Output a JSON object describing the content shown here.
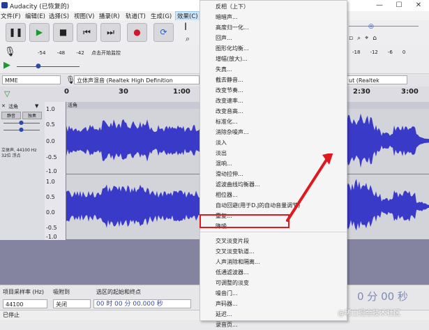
{
  "window": {
    "title": "Audacity (已恢复的)",
    "minimize": "—",
    "maximize": "☐",
    "close": "✕"
  },
  "menubar": [
    "文件(F)",
    "编辑(E)",
    "选择(S)",
    "视图(V)",
    "播录(R)",
    "轨道(T)",
    "生成(G)",
    "效果(C)"
  ],
  "transport": [
    "pause",
    "play",
    "stop",
    "skip-start",
    "skip-end",
    "record",
    "loop"
  ],
  "meter": {
    "ticks": [
      "-54",
      "-48",
      "-42"
    ],
    "hint": "点击开始监控",
    "ticks_right": [
      "-18",
      "-12",
      "-6",
      "0"
    ]
  },
  "device": {
    "host": "MME",
    "input": "立体声混音 (Realtek High Definition",
    "output_tail": "ut (Realtek"
  },
  "ruler": {
    "labels": [
      "0",
      "30",
      "1:00",
      "2:30",
      "3:00"
    ]
  },
  "track": {
    "close": "✕",
    "name": "活角",
    "mute": "静音",
    "solo": "独奏",
    "info": "立体声, 44100 Hz\n32位 浮点",
    "clip_name": "活角",
    "scale_top": [
      "1.0",
      "0.5",
      "0.0",
      "-0.5",
      "-1.0"
    ],
    "scale_bottom": [
      "1.0",
      "0.5",
      "0.0",
      "-0.5",
      "-1.0"
    ]
  },
  "selection_bar": {
    "rate_label": "项目采样率 (Hz)",
    "snap_label": "吸附到",
    "range_label": "选区的起始和终点",
    "rate_value": "44100",
    "snap_value": "关闭",
    "time_value": "00 时 00 分 00.000 秒",
    "time_right": "0 分 00 秒"
  },
  "status": "已停止",
  "effects_menu": {
    "items": [
      "反相（上下）",
      "暗暗声...",
      "高度归一化...",
      "回声...",
      "图形化均衡...",
      "增幅(放大)...",
      "失真...",
      "截去静音...",
      "改变节奏...",
      "改变速率...",
      "改变音高...",
      "标准化...",
      "消除杂噪声...",
      "淡入",
      "淡出",
      "混响...",
      "滑动拉伸...",
      "滤波曲线均衡器...",
      "相位器...",
      "自动回避(用于D.J的自动音量调节)",
      "重复...",
      "降噪...",
      "交叉淡变片段",
      "交叉淡变轨道...",
      "人声消除和隔离...",
      "低通滤波器...",
      "可调整的淡变",
      "噪音门...",
      "声码器...",
      "延迟...",
      "录音页..."
    ],
    "highlighted": "降噪..."
  },
  "watermark": "@稀土掘金技术社区",
  "colors": {
    "waveform": "#3a3ac8",
    "highlight_box": "#e0191e",
    "arrow": "#e0191e"
  }
}
